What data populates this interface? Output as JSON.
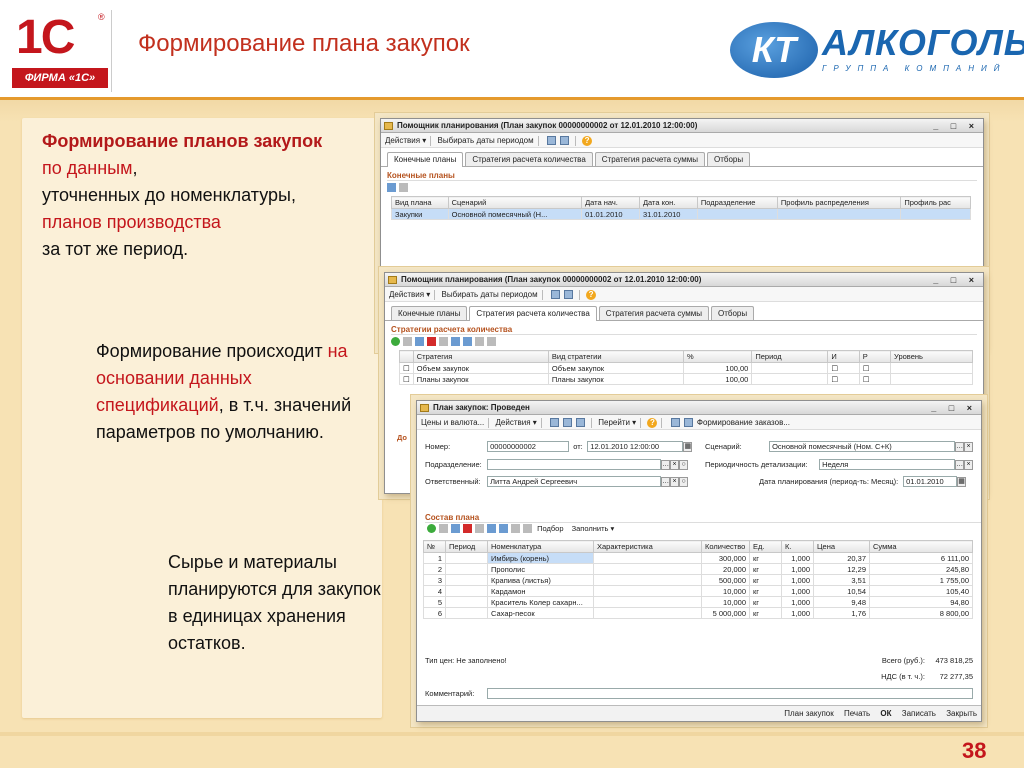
{
  "header": {
    "logo_text": "1С",
    "logo_firm": "ФИРМА «1С»",
    "title": "Формирование плана закупок",
    "kt_mark": "КТ",
    "kt_word": "АЛКОГОЛЬ",
    "kt_sub": "ГРУППА КОМПАНИЙ"
  },
  "text1": {
    "bold": "Формирование планов закупок",
    "red1": "по данным",
    "plain1": ",",
    "plain2": "уточненных до номенклатуры,",
    "red2": "планов производства",
    "plain3": "за тот же период."
  },
  "text2": {
    "plain1": "Формирование происходит",
    "red": "на основании данных спецификаций",
    "plain2": ", в т.ч. значений параметров по умолчанию."
  },
  "text3": "Сырье и материалы планируются для закупок в единицах хранения остатков.",
  "win1": {
    "title": "Помощник планирования (План закупок 00000000002 от 12.01.2010 12:00:00)",
    "controls": "_ □ ×",
    "toolbar": [
      "Действия ▾",
      "Выбирать даты периодом"
    ],
    "tabs": [
      "Конечные планы",
      "Стратегия расчета количества",
      "Стратегия расчета суммы",
      "Отборы"
    ],
    "section": "Конечные планы",
    "columns": [
      "Вид плана",
      "Сценарий",
      "Дата нач.",
      "Дата кон.",
      "Подразделение",
      "Профиль распределения",
      "Профиль рас"
    ],
    "rows": [
      [
        "Закупки",
        "Основной помесячный (Н...",
        "01.01.2010",
        "31.01.2010",
        "",
        "",
        ""
      ]
    ]
  },
  "win2": {
    "title": "Помощник планирования (План закупок 00000000002 от 12.01.2010 12:00:00)",
    "controls": "_ □ ×",
    "toolbar": [
      "Действия ▾",
      "Выбирать даты периодом"
    ],
    "tabs": [
      "Конечные планы",
      "Стратегия расчета количества",
      "Стратегия расчета суммы",
      "Отборы"
    ],
    "section": "Стратегии расчета количества",
    "columns": [
      "Стратегия",
      "Вид стратегии",
      "%",
      "Период",
      "И",
      "Р",
      "Уровень"
    ],
    "rows": [
      [
        "Объем закупок",
        "Объем закупок",
        "100,00",
        "",
        "",
        "",
        ""
      ],
      [
        "Планы закупок",
        "Планы закупок",
        "100,00",
        "",
        "",
        "",
        ""
      ]
    ],
    "side_label": "До"
  },
  "win3": {
    "title": "План закупок: Проведен",
    "controls": "_ □ ×",
    "toolbar": [
      "Цены и валюта...",
      "Действия ▾",
      "Перейти ▾",
      "Формирование заказов..."
    ],
    "fields": {
      "number_label": "Номер:",
      "number": "00000000002",
      "from_label": "от:",
      "date": "12.01.2010 12:00:00",
      "scenario_label": "Сценарий:",
      "scenario": "Основной помесячный (Ном. С+К)",
      "division_label": "Подразделение:",
      "division": "",
      "periodicity_label": "Периодичность детализации:",
      "periodicity": "Неделя",
      "responsible_label": "Ответственный:",
      "responsible": "Литта Андрей Сергеевич",
      "plan_date_label": "Дата планирования (период-ть: Месяц):",
      "plan_date": "01.01.2010"
    },
    "section": "Состав плана",
    "table_toolbar": [
      "Подбор",
      "Заполнить ▾"
    ],
    "columns": [
      "№",
      "Период",
      "Номенклатура",
      "Характеристика",
      "Количество",
      "Ед.",
      "К.",
      "Цена",
      "Сумма"
    ],
    "rows": [
      [
        "1",
        "",
        "Имбирь (корень)",
        "",
        "300,000",
        "кг",
        "1,000",
        "20,37",
        "6 111,00"
      ],
      [
        "2",
        "",
        "Прополис",
        "",
        "20,000",
        "кг",
        "1,000",
        "12,29",
        "245,80"
      ],
      [
        "3",
        "",
        "Крапива (листья)",
        "",
        "500,000",
        "кг",
        "1,000",
        "3,51",
        "1 755,00"
      ],
      [
        "4",
        "",
        "Кардамон",
        "",
        "10,000",
        "кг",
        "1,000",
        "10,54",
        "105,40"
      ],
      [
        "5",
        "",
        "Краситель Колер сахарн...",
        "",
        "10,000",
        "кг",
        "1,000",
        "9,48",
        "94,80"
      ],
      [
        "6",
        "",
        "Сахар-песок",
        "",
        "5 000,000",
        "кг",
        "1,000",
        "1,76",
        "8 800,00"
      ]
    ],
    "price_type": "Тип цен: Не заполнено!",
    "total_label": "Всего (руб.):",
    "total": "473 818,25",
    "vat_label": "НДС (в т. ч.):",
    "vat": "72 277,35",
    "comment_label": "Комментарий:",
    "buttons": [
      "План закупок",
      "Печать",
      "ОК",
      "Записать",
      "Закрыть"
    ]
  },
  "page_number": "38"
}
